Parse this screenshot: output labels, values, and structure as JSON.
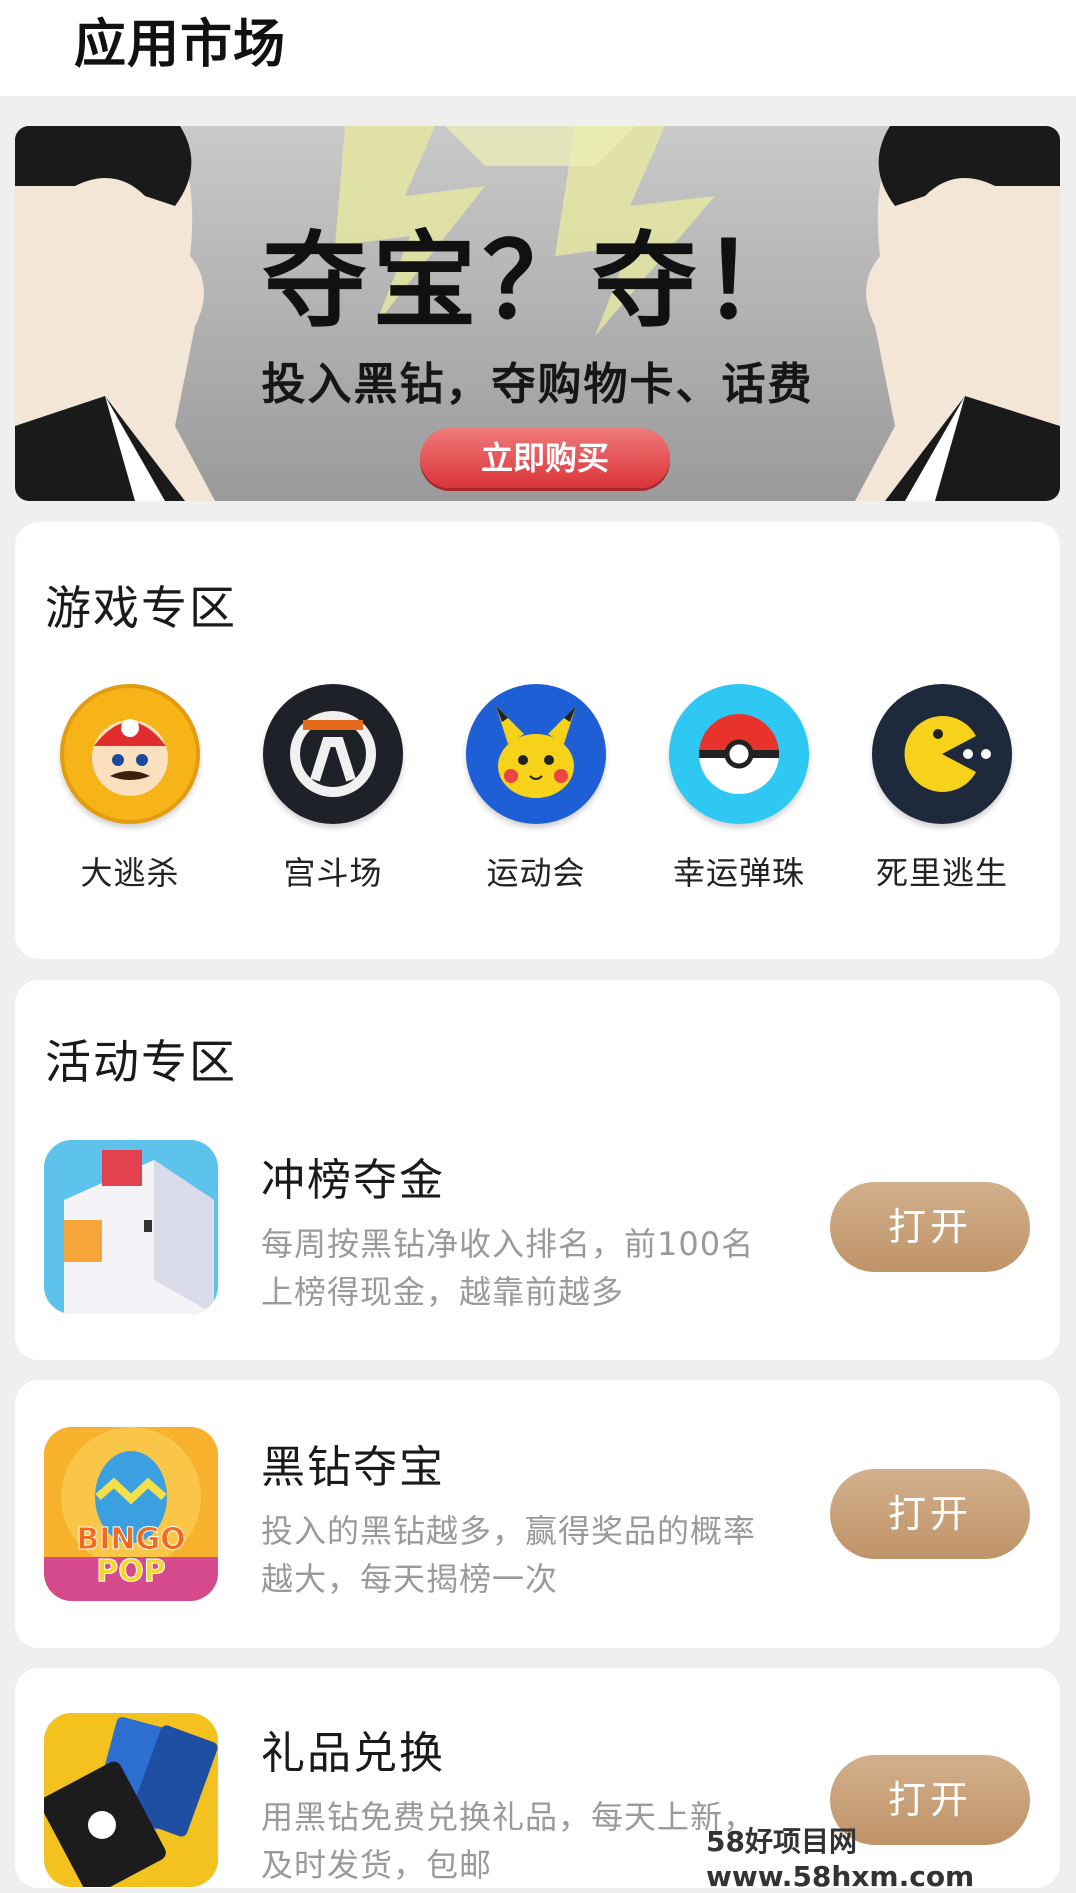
{
  "header": {
    "title": "应用市场"
  },
  "banner": {
    "title": "夺宝？夺！",
    "subtitle": "投入黑钻，夺购物卡、话费",
    "button_label": "立即购买"
  },
  "games_section": {
    "title": "游戏专区",
    "items": [
      {
        "label": "大逃杀",
        "icon": "mario-face-icon",
        "color": "#f6b418"
      },
      {
        "label": "宫斗场",
        "icon": "overwatch-logo-icon",
        "color": "#1e2228"
      },
      {
        "label": "运动会",
        "icon": "pikachu-icon",
        "color": "#1f5fd6"
      },
      {
        "label": "幸运弹珠",
        "icon": "pokeball-icon",
        "color": "#2fc8f2"
      },
      {
        "label": "死里逃生",
        "icon": "pacman-icon",
        "color": "#1e2a3c"
      }
    ]
  },
  "activity_section": {
    "title": "活动专区",
    "items": [
      {
        "title": "冲榜夺金",
        "description": "每周按黑钻净收入排名，前100名上榜得现金，越靠前越多",
        "button_label": "打开",
        "icon": "crossy-chicken-icon"
      },
      {
        "title": "黑钻夺宝",
        "description": "投入的黑钻越多，赢得奖品的概率越大，每天揭榜一次",
        "button_label": "打开",
        "icon": "bingo-pop-icon"
      },
      {
        "title": "礼品兑换",
        "description": "用黑钻免费兑换礼品，每天上新，及时发货，包邮",
        "button_label": "打开",
        "icon": "gift-cards-icon"
      }
    ]
  },
  "watermark": "58好项目网www.58hxm.com"
}
